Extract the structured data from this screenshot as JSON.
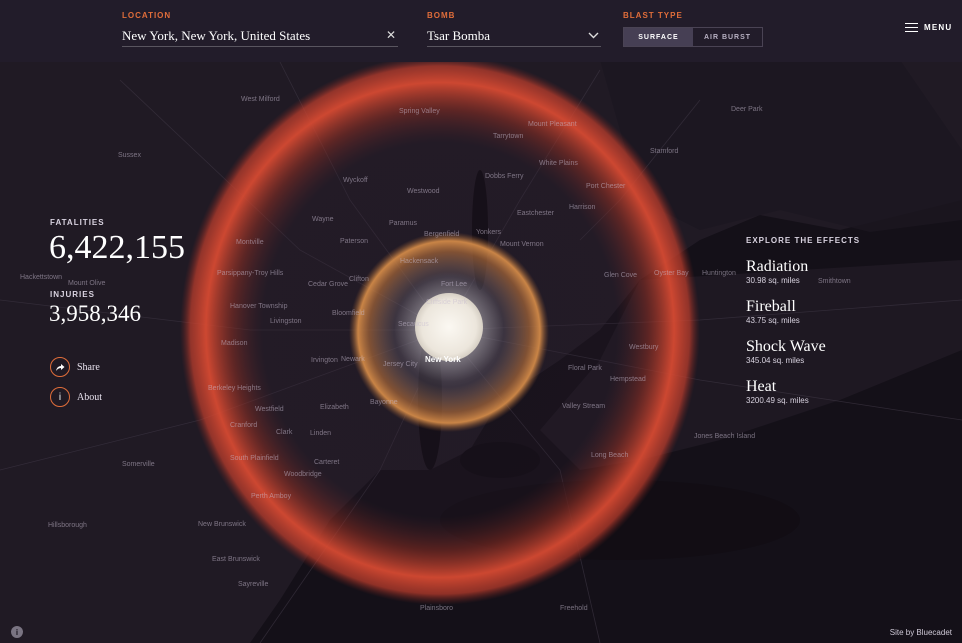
{
  "header": {
    "location": {
      "label": "LOCATION",
      "value": "New York, New York, United States",
      "clear_icon": "close-icon"
    },
    "bomb": {
      "label": "BOMB",
      "value": "Tsar Bomba",
      "dropdown_icon": "chevron-down-icon"
    },
    "blast_type": {
      "label": "BLAST TYPE",
      "options": [
        "SURFACE",
        "AIR BURST"
      ],
      "selected": "SURFACE"
    },
    "menu": {
      "label": "MENU",
      "icon": "hamburger-icon"
    }
  },
  "stats": {
    "fatalities_label": "FATALITIES",
    "fatalities_value": "6,422,155",
    "injuries_label": "INJURIES",
    "injuries_value": "3,958,346"
  },
  "actions": {
    "share": {
      "label": "Share",
      "icon": "share-arrow-icon"
    },
    "about": {
      "label": "About",
      "icon": "info-icon"
    }
  },
  "effects": {
    "title": "EXPLORE THE EFFECTS",
    "items": [
      {
        "name": "Radiation",
        "area": "30.98 sq. miles"
      },
      {
        "name": "Fireball",
        "area": "43.75 sq. miles"
      },
      {
        "name": "Shock Wave",
        "area": "345.04 sq. miles"
      },
      {
        "name": "Heat",
        "area": "3200.49 sq. miles"
      }
    ]
  },
  "map": {
    "center_label": "New York",
    "places": [
      "West Milford",
      "Spring Valley",
      "Tarrytown",
      "Mount Pleasant",
      "White Plains",
      "Stamford",
      "Wyckoff",
      "Westwood",
      "Dobbs Ferry",
      "Port Chester",
      "Harrison",
      "Eastchester",
      "Wayne",
      "Paramus",
      "Bergenfield",
      "Yonkers",
      "Mount Vernon",
      "Paterson",
      "Montville",
      "Hackensack",
      "Fort Lee",
      "Glen Cove",
      "Oyster Bay",
      "Huntington",
      "Cedar Grove",
      "Clifton",
      "Cliffside Park",
      "Hanover Township",
      "Parsippany-Troy Hills",
      "Livingston",
      "Bloomfield",
      "Secaucus",
      "Madison",
      "Irvington",
      "Newark",
      "Jersey City",
      "Westbury",
      "Floral Park",
      "Hempstead",
      "Elizabeth",
      "Bayonne",
      "Westfield",
      "Berkeley Heights",
      "Cranford",
      "Clark",
      "Linden",
      "Valley Stream",
      "Long Beach",
      "Jones Beach Island",
      "Carteret",
      "South Plainfield",
      "Woodbridge",
      "Somerville",
      "Perth Amboy",
      "New Brunswick",
      "Hillsborough",
      "East Brunswick",
      "Sayreville",
      "Plainsboro",
      "Freehold",
      "Hackettstown",
      "Mount Olive",
      "Sussex",
      "Smithtown",
      "Deer Park"
    ]
  },
  "footer": {
    "info_icon": "info-icon",
    "credit": "Site by Bluecadet"
  },
  "colors": {
    "header_bg": "#221c2a",
    "accent": "#e06d3a",
    "heat_ring": "#c83a28",
    "shock_ring": "#c4763a",
    "fireball": "#f4f0e8",
    "map_bg": "#141018"
  }
}
